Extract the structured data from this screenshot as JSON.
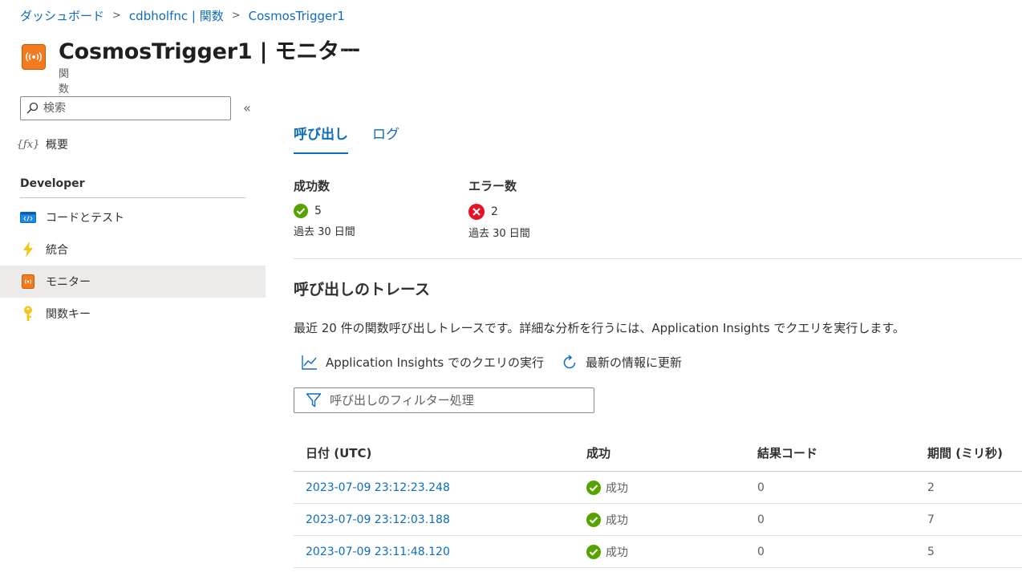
{
  "breadcrumb": [
    "ダッシュボード",
    "cdbholfnc | 関数",
    "CosmosTrigger1"
  ],
  "header": {
    "title": "CosmosTrigger1 | モニター",
    "subtitle": "関数",
    "more": "…"
  },
  "sidebar": {
    "search_placeholder": "検索",
    "collapse": "«",
    "overview": "概要",
    "section": "Developer",
    "items": [
      {
        "label": "コードとテスト",
        "icon": "code-icon"
      },
      {
        "label": "統合",
        "icon": "lightning-icon"
      },
      {
        "label": "モニター",
        "icon": "monitor-icon",
        "active": true
      },
      {
        "label": "関数キー",
        "icon": "key-icon"
      }
    ]
  },
  "tabs": [
    "呼び出し",
    "ログ"
  ],
  "stats": {
    "success": {
      "label": "成功数",
      "value": "5",
      "period": "過去 30 日間"
    },
    "error": {
      "label": "エラー数",
      "value": "2",
      "period": "過去 30 日間"
    }
  },
  "section_title": "呼び出しのトレース",
  "description": "最近 20 件の関数呼び出しトレースです。詳細な分析を行うには、Application Insights でクエリを実行します。",
  "toolbar": {
    "run_query": "Application Insights でのクエリの実行",
    "refresh": "最新の情報に更新"
  },
  "filter_placeholder": "呼び出しのフィルター処理",
  "table": {
    "headers": [
      "日付 (UTC)",
      "成功",
      "結果コード",
      "期間 (ミリ秒)"
    ],
    "rows": [
      {
        "date": "2023-07-09 23:12:23.248",
        "status": "成功",
        "code": "0",
        "duration": "2"
      },
      {
        "date": "2023-07-09 23:12:03.188",
        "status": "成功",
        "code": "0",
        "duration": "7"
      },
      {
        "date": "2023-07-09 23:11:48.120",
        "status": "成功",
        "code": "0",
        "duration": "5"
      }
    ]
  },
  "colors": {
    "accent": "#0f6cbd",
    "success": "#57a300",
    "error": "#e81123",
    "function_orange": "#f27a1f"
  }
}
